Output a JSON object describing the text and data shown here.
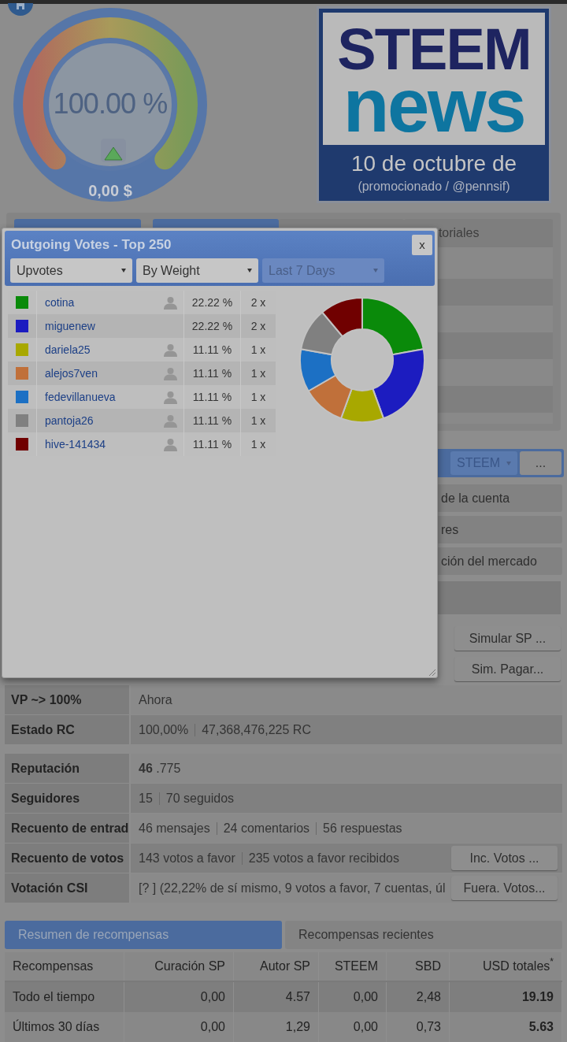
{
  "gauge": {
    "percent": "100.00 %",
    "value": "0,00 $"
  },
  "banner": {
    "logo_top": "STEEM",
    "logo_bottom": "news",
    "date": "10 de octubre de",
    "caption": "(promocionado / @pennsif)"
  },
  "top_tabs": [
    {
      "selected": true
    },
    {
      "selected": true
    },
    {
      "selected": false
    },
    {
      "selected": false,
      "label": "toriales"
    }
  ],
  "wallet_toolbar": {
    "currency": "STEEM",
    "more": "..."
  },
  "menu_items": [
    "de la cuenta",
    "res",
    "ción del mercado"
  ],
  "sim_buttons": [
    "Simular SP ...",
    "Sim. Pagar..."
  ],
  "info_groups": [
    [
      {
        "label": "VP ~> 100%",
        "values": [
          "Ahora"
        ]
      },
      {
        "label": "Estado RC",
        "values": [
          "100,00%",
          "47,368,476,225 RC"
        ]
      }
    ],
    [
      {
        "label": "Reputación",
        "values": [
          "**46** .775"
        ]
      },
      {
        "label": "Seguidores",
        "values": [
          "15",
          "70 seguidos"
        ]
      },
      {
        "label": "Recuento de entrad",
        "values": [
          "46 mensajes",
          "24 comentarios",
          "56 respuestas"
        ]
      },
      {
        "label": "Recuento de votos",
        "values": [
          "143 votos a favor",
          "235 votos a favor recibidos"
        ],
        "button": "Inc. Votos ..."
      },
      {
        "label": "Votación CSI",
        "values": [
          "[? ] (22,22% de sí mismo, 9 votos a favor, 7 cuentas, úl"
        ],
        "button": "Fuera. Votos..."
      }
    ]
  ],
  "reward_tabs": [
    {
      "label": "Resumen de recompensas",
      "selected": true
    },
    {
      "label": "Recompensas recientes",
      "selected": false
    }
  ],
  "rewards_table": {
    "columns": [
      "Recompensas",
      "Curación SP",
      "Autor SP",
      "STEEM",
      "SBD",
      "USD totales$^{*}$"
    ],
    "rows": [
      [
        "Todo el tiempo",
        "0,00",
        "4.57",
        "0,00",
        "2,48",
        "19.19"
      ],
      [
        "Últimos 30 días",
        "0,00",
        "1,29",
        "0,00",
        "0,73",
        "5.63"
      ]
    ]
  },
  "popup": {
    "title": "Outgoing Votes - Top 250",
    "close": "x",
    "filters": [
      {
        "value": "Upvotes",
        "disabled": false
      },
      {
        "value": "By Weight",
        "disabled": false
      },
      {
        "value": "Last 7 Days",
        "disabled": true
      }
    ],
    "votes": [
      {
        "name": "cotina",
        "color": "#0a8a0a",
        "profile_icon": true,
        "share": "22.22 %",
        "count": "2 x"
      },
      {
        "name": "miguenew",
        "color": "#1c1cc0",
        "profile_icon": false,
        "share": "22.22 %",
        "count": "2 x"
      },
      {
        "name": "dariela25",
        "color": "#a8a800",
        "profile_icon": true,
        "share": "11.11 %",
        "count": "1 x"
      },
      {
        "name": "alejos7ven",
        "color": "#c0703a",
        "profile_icon": true,
        "share": "11.11 %",
        "count": "1 x"
      },
      {
        "name": "fedevillanueva",
        "color": "#1c70c4",
        "profile_icon": true,
        "share": "11.11 %",
        "count": "1 x"
      },
      {
        "name": "pantoja26",
        "color": "#808080",
        "profile_icon": true,
        "share": "11.11 %",
        "count": "1 x"
      },
      {
        "name": "hive-141434",
        "color": "#700000",
        "profile_icon": true,
        "share": "11.11 %",
        "count": "1 x"
      }
    ],
    "chart_data": {
      "type": "donut",
      "values": [
        22.22,
        22.22,
        11.11,
        11.11,
        11.11,
        11.11,
        11.11
      ]
    }
  }
}
